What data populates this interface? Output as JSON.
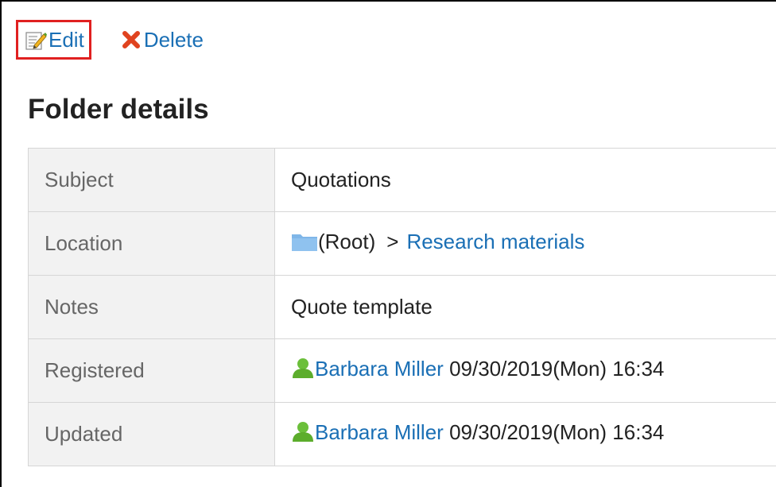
{
  "toolbar": {
    "edit_label": "Edit",
    "delete_label": "Delete"
  },
  "page_title": "Folder details",
  "details": {
    "subject_label": "Subject",
    "subject_value": "Quotations",
    "location_label": "Location",
    "location_root": "(Root)",
    "location_separator": ">",
    "location_folder": "Research materials",
    "notes_label": "Notes",
    "notes_value": "Quote template",
    "registered_label": "Registered",
    "registered_user": "Barbara Miller",
    "registered_datetime": "09/30/2019(Mon) 16:34",
    "updated_label": "Updated",
    "updated_user": "Barbara Miller",
    "updated_datetime": "09/30/2019(Mon) 16:34"
  },
  "icons": {
    "edit": "edit-pencil-icon",
    "delete": "red-x-icon",
    "folder": "folder-icon",
    "user": "user-icon"
  },
  "colors": {
    "link": "#1a6fb5",
    "highlight_border": "#e02020",
    "label_bg": "#f2f2f2",
    "delete_x": "#e0431f",
    "folder": "#7fb6e8",
    "user": "#5cad2c"
  }
}
